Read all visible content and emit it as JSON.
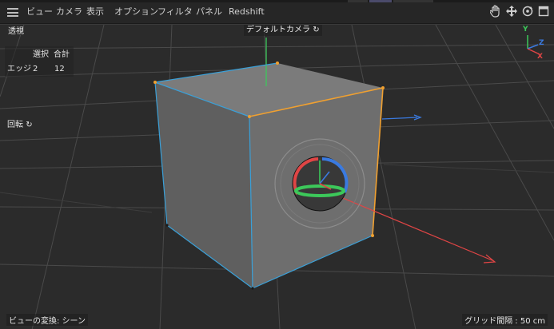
{
  "menu": {
    "items": [
      "ビュー",
      "カメラ",
      "表示",
      "オプション",
      "フィルタ",
      "パネル",
      "Redshift"
    ]
  },
  "toolbar_icons": [
    "hand-pan-icon",
    "move-arrows-icon",
    "rotate-orbit-icon",
    "maximize-view-icon"
  ],
  "viewport": {
    "view_name": "透視",
    "camera_label": "デフォルトカメラ",
    "camera_icon": "camera-cycle-icon",
    "hud": {
      "header_select": "選択",
      "header_total": "合計",
      "row_label": "エッジ",
      "row_select": "2",
      "row_total": "12"
    },
    "rotate_label": "回転",
    "transform_label": "ビューの変換: シーン",
    "grid_label": "グリッド間隔 : 50 cm",
    "axis_letters": {
      "y": "Y",
      "z": "Z",
      "x": "X"
    }
  },
  "colors": {
    "menubar_bg": "#262626",
    "viewport_bg": "#2b2b2b",
    "cube_face": "#6b6b6b",
    "edge_blue": "#3aa0d8",
    "edge_orange": "#f0a030",
    "axis_x": "#e04545",
    "axis_y": "#3cc85a",
    "axis_z": "#3a7ae0"
  }
}
